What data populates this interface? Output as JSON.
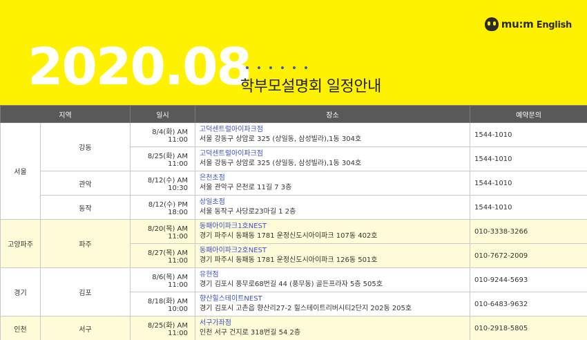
{
  "brand": {
    "mark": "mu:m",
    "word": "English"
  },
  "header": {
    "year": "2020.08",
    "subtitle": "학부모설명회 일정안내"
  },
  "table": {
    "headers": [
      "지역",
      "일시",
      "장소",
      "예약문의"
    ],
    "rows": [
      {
        "region": "서울",
        "district": "강동",
        "datetime": "8/4(화) AM 11:00",
        "place": "고덕센트럴아이파크점",
        "address": "서울 강동구 상암로 325 (상일동, 삼성빌라),1동 304호",
        "phone": "1544-1010"
      },
      {
        "region": "",
        "district": "",
        "datetime": "8/25(화) AM 11:00",
        "place": "고덕센트럴아이파크점",
        "address": "서울 강동구 상암로 325 (상일동, 삼성빌라),1동 304호",
        "phone": "1544-1010"
      },
      {
        "region": "",
        "district": "관악",
        "datetime": "8/12(수) AM 10:30",
        "place": "은천초점",
        "address": "서울 관악구 은천로 11길 7 3층",
        "phone": "1544-1010"
      },
      {
        "region": "",
        "district": "동작",
        "datetime": "8/12(수) PM 18:00",
        "place": "상일초점",
        "address": "서울 동작구 사당로23마길 1 2층",
        "phone": "1544-1010"
      },
      {
        "region": "고양파주",
        "district": "파주",
        "datetime": "8/20(목) AM 11:00",
        "place": "동패아이파크1호NEST",
        "address": "경기 파주시 동패동 1781 운정신도시아이파크 107동 402호",
        "phone": "010-3338-3266"
      },
      {
        "region": "",
        "district": "",
        "datetime": "8/27(목) AM 11:00",
        "place": "동패아이파크2호NEST",
        "address": "경기 파주시 동패동 1781 운정신도시아이파크 126동 501호",
        "phone": "010-7672-2009"
      },
      {
        "region": "경기",
        "district": "김포",
        "datetime": "8/6(목) AM 11:00",
        "place": "유현점",
        "address": "경기 김포시 풍무로68번길 44 (풍무동) 골든프라자 5층 505호",
        "phone": "010-9244-5693"
      },
      {
        "region": "",
        "district": "",
        "datetime": "8/18(화) AM 10:00",
        "place": "향산힐스테이트NEST",
        "address": "경기 김포시 고촌읍 향산리27-2 힐스테이트리버시티2단지 202동 205호",
        "phone": "010-6483-9632"
      },
      {
        "region": "인천",
        "district": "서구",
        "datetime": "8/25(화) AM 11:00",
        "place": "서구가좌점",
        "address": "인천 서구 건지로 318번길 54 2층",
        "phone": "010-2918-5805"
      }
    ]
  }
}
